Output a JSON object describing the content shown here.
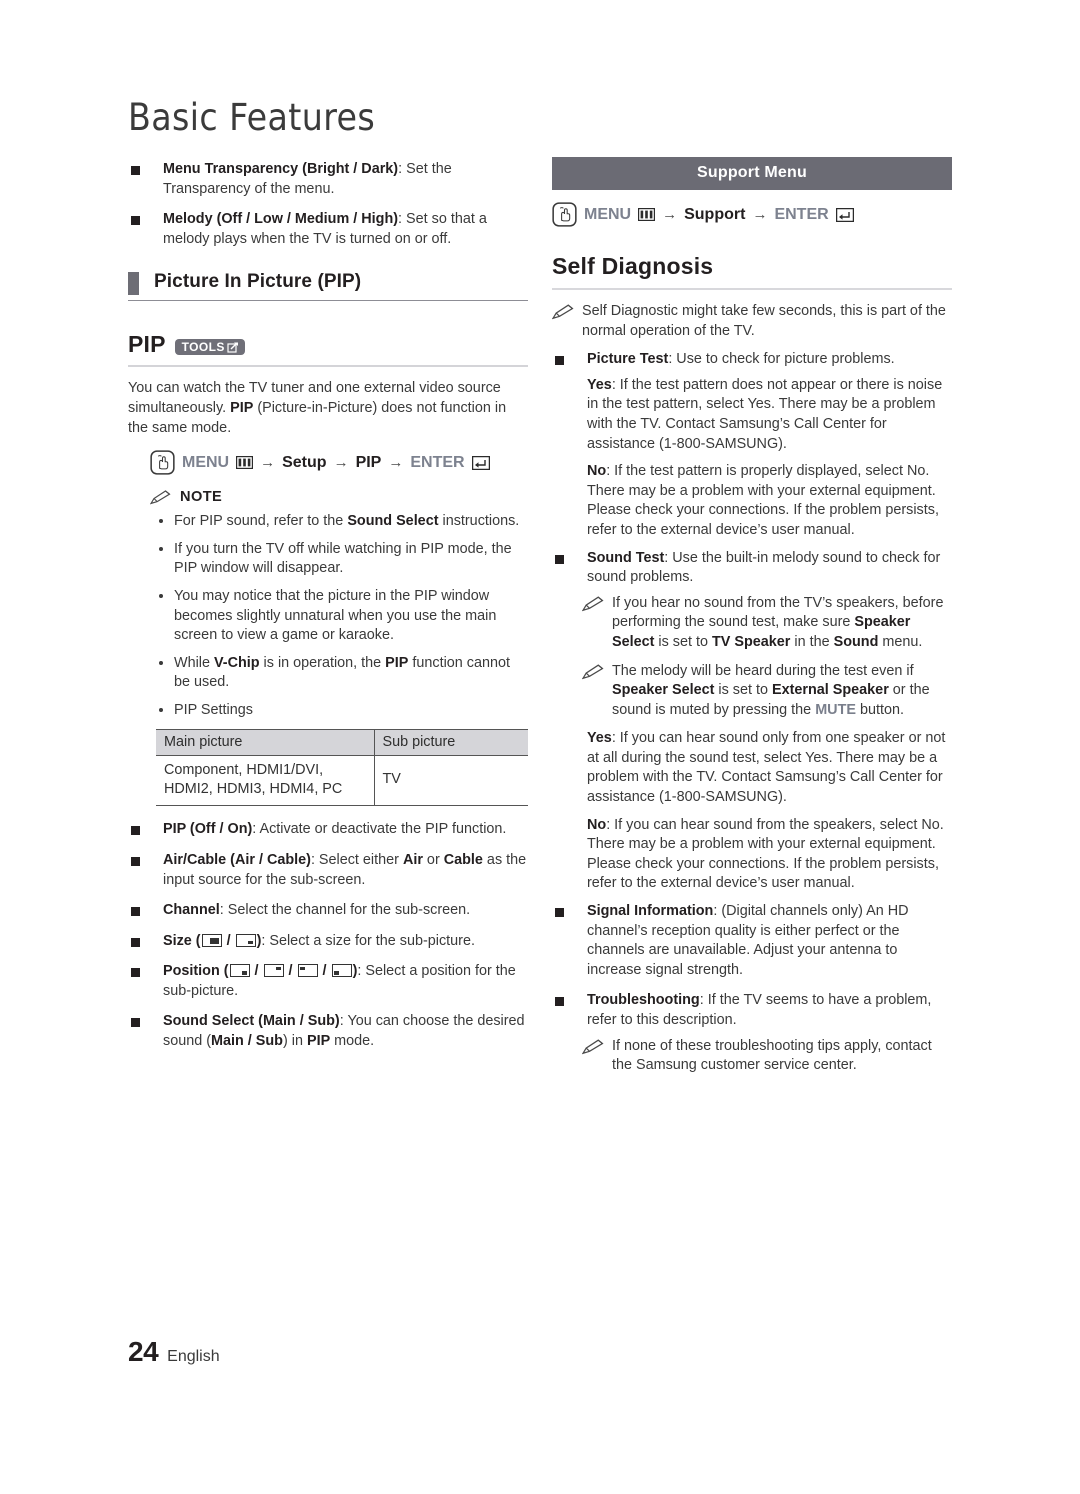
{
  "document": {
    "title": "Basic Features",
    "footer": {
      "page_number": "24",
      "language": "English"
    }
  },
  "left_column": {
    "top_bullets": [
      {
        "label": "Menu Transparency (Bright / Dark)",
        "text": ": Set the Transparency of the menu."
      },
      {
        "label": "Melody (Off / Low / Medium / High)",
        "text": ": Set so that a melody plays when the TV is turned on or off."
      }
    ],
    "section_heading": "Picture In Picture (PIP)",
    "pip": {
      "heading": "PIP",
      "tools_badge": "TOOLS",
      "description_a": "You can watch the TV tuner and one external video source simultaneously. ",
      "description_b": "PIP",
      "description_c": " (Picture-in-Picture) does not function in the same mode.",
      "menu_path": {
        "menu": "MENU",
        "arrow": "→",
        "step1": "Setup",
        "step2": "PIP",
        "enter": "ENTER"
      }
    },
    "note": {
      "title": "NOTE",
      "items": [
        {
          "pre": "For PIP sound, refer to the ",
          "bold": "Sound Select",
          "post": " instructions."
        },
        {
          "pre": "If you turn the TV off while watching in PIP mode, the PIP window will disappear.",
          "bold": "",
          "post": ""
        },
        {
          "pre": "You may notice that the picture in the PIP window becomes slightly unnatural when you use the main screen to view a game or karaoke.",
          "bold": "",
          "post": ""
        },
        {
          "pre": "While ",
          "bold": "V-Chip",
          "mid": " is in operation, the ",
          "bold2": "PIP",
          "post": " function cannot be used."
        },
        {
          "pre": "PIP Settings",
          "bold": "",
          "post": ""
        }
      ]
    },
    "table": {
      "headers": [
        "Main picture",
        "Sub picture"
      ],
      "rows": [
        {
          "main": "Component, HDMI1/DVI, HDMI2, HDMI3, HDMI4, PC",
          "sub": "TV"
        }
      ]
    },
    "settings_bullets": [
      {
        "label": "PIP (Off / On)",
        "text": ": Activate or deactivate the PIP function."
      },
      {
        "label": "Air/Cable (Air / Cable)",
        "text": ": Select either ",
        "bold_a": "Air",
        "text2": " or ",
        "bold_b": "Cable",
        "text3": " as the input source for the sub-screen."
      },
      {
        "label": "Channel",
        "text": ": Select the channel for the sub-screen."
      },
      {
        "label": "Size",
        "icons": [
          "size-large-icon",
          "size-small-icon"
        ],
        "text": ": Select a size for the sub-picture."
      },
      {
        "label": "Position",
        "icons": [
          "position-bottom-right-icon",
          "position-top-right-icon",
          "position-top-left-icon",
          "position-bottom-left-icon"
        ],
        "text": ": Select a position for the sub-picture."
      },
      {
        "label": "Sound Select (Main / Sub)",
        "text": ": You can choose the desired sound (",
        "bold_a": "Main / Sub",
        "text2": ") in ",
        "bold_b": "PIP",
        "text3": " mode."
      }
    ]
  },
  "right_column": {
    "banner": "Support Menu",
    "menu_path": {
      "menu": "MENU",
      "arrow": "→",
      "step1": "Support",
      "enter": "ENTER"
    },
    "heading": "Self Diagnosis",
    "intro_note": "Self Diagnostic might take few seconds, this is part of the normal operation of the TV.",
    "picture_test": {
      "label": "Picture Test",
      "text": ": Use to check for picture problems.",
      "yes_label": "Yes",
      "yes_text": ": If the test pattern does not appear or there is noise in the test pattern, select Yes. There may be a problem with the TV. Contact Samsung’s Call Center for assistance (1-800-SAMSUNG).",
      "no_label": "No",
      "no_text": ": If the test pattern is properly displayed, select No. There may be a problem with your external equipment. Please check your connections. If the problem persists, refer to the external device’s user manual."
    },
    "sound_test": {
      "label": "Sound Test",
      "text": ": Use the built-in melody sound to check for sound problems.",
      "note1_a": "If you hear no sound from the TV’s speakers, before performing the sound test, make sure ",
      "note1_b": "Speaker Select",
      "note1_c": " is set to ",
      "note1_d": "TV Speaker",
      "note1_e": " in the ",
      "note1_f": "Sound",
      "note1_g": " menu.",
      "note2_a": "The melody will be heard during the test even if ",
      "note2_b": "Speaker Select",
      "note2_c": " is set to ",
      "note2_d": "External Speaker",
      "note2_e": " or the sound is muted by pressing the ",
      "note2_f": "MUTE",
      "note2_g": " button.",
      "yes_label": "Yes",
      "yes_text": ": If you can hear sound only from one speaker or not at all during the sound test, select Yes. There may be a problem with the TV. Contact Samsung’s Call Center for assistance (1-800-SAMSUNG).",
      "no_label": "No",
      "no_text": ": If you can hear sound from the speakers, select No. There may be a problem with your external equipment. Please check your connections. If the problem persists, refer to the external device’s user manual."
    },
    "signal_information": {
      "label": "Signal Information",
      "text": ": (Digital channels only) An HD channel’s reception quality is either perfect or the channels are unavailable. Adjust your antenna to increase signal strength."
    },
    "troubleshooting": {
      "label": "Troubleshooting",
      "text": ": If the TV seems to have a problem, refer to this description.",
      "note": "If none of these troubleshooting tips apply, contact the Samsung customer service center."
    }
  },
  "colors": {
    "banner_gray": "#6b6b74",
    "marker_gray": "#6d6d75",
    "chip_gray": "#6f6f78",
    "key_text": "#7d828f",
    "body_text": "#3a3a3a",
    "bold_text": "#231f20",
    "table_header": "#d5d5d9"
  }
}
